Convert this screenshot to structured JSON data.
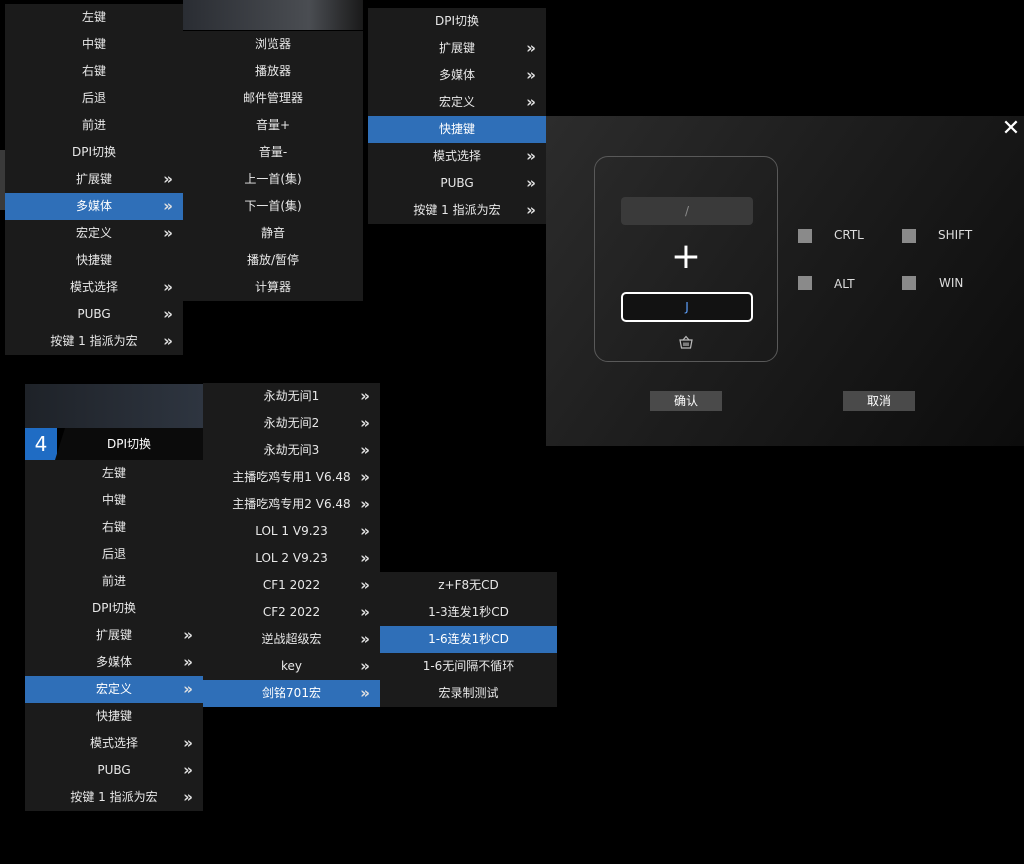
{
  "menu1": {
    "items": [
      {
        "label": "左键",
        "arrow": ""
      },
      {
        "label": "中键",
        "arrow": ""
      },
      {
        "label": "右键",
        "arrow": ""
      },
      {
        "label": "后退",
        "arrow": ""
      },
      {
        "label": "前进",
        "arrow": ""
      },
      {
        "label": "DPI切换",
        "arrow": ""
      },
      {
        "label": "扩展键",
        "arrow": "»"
      },
      {
        "label": "多媒体",
        "arrow": "»"
      },
      {
        "label": "宏定义",
        "arrow": "»"
      },
      {
        "label": "快捷键",
        "arrow": ""
      },
      {
        "label": "模式选择",
        "arrow": "»"
      },
      {
        "label": "PUBG",
        "arrow": "»"
      },
      {
        "label": "按键 1 指派为宏",
        "arrow": "»"
      }
    ],
    "selected_index": 7
  },
  "menu1_sub": {
    "items": [
      {
        "label": "浏览器"
      },
      {
        "label": "播放器"
      },
      {
        "label": "邮件管理器"
      },
      {
        "label": "音量+"
      },
      {
        "label": "音量-"
      },
      {
        "label": "上一首(集)"
      },
      {
        "label": "下一首(集)"
      },
      {
        "label": "静音"
      },
      {
        "label": "播放/暂停"
      },
      {
        "label": "计算器"
      }
    ]
  },
  "menu2": {
    "items": [
      {
        "label": "DPI切换",
        "arrow": ""
      },
      {
        "label": "扩展键",
        "arrow": "»"
      },
      {
        "label": "多媒体",
        "arrow": "»"
      },
      {
        "label": "宏定义",
        "arrow": "»"
      },
      {
        "label": "快捷键",
        "arrow": ""
      },
      {
        "label": "模式选择",
        "arrow": "»"
      },
      {
        "label": "PUBG",
        "arrow": "»"
      },
      {
        "label": "按键 1 指派为宏",
        "arrow": "»"
      }
    ],
    "selected_index": 4
  },
  "dialog": {
    "close_glyph": "✕",
    "display_value": "/",
    "plus_glyph": "+",
    "key_value": "J",
    "modifiers": [
      {
        "label": "CRTL"
      },
      {
        "label": "SHIFT"
      },
      {
        "label": "ALT"
      },
      {
        "label": "WIN"
      }
    ],
    "confirm_label": "确认",
    "cancel_label": "取消"
  },
  "menu3": {
    "header_number": "4",
    "header_label": "DPI切换",
    "items": [
      {
        "label": "左键",
        "arrow": ""
      },
      {
        "label": "中键",
        "arrow": ""
      },
      {
        "label": "右键",
        "arrow": ""
      },
      {
        "label": "后退",
        "arrow": ""
      },
      {
        "label": "前进",
        "arrow": ""
      },
      {
        "label": "DPI切换",
        "arrow": ""
      },
      {
        "label": "扩展键",
        "arrow": "»"
      },
      {
        "label": "多媒体",
        "arrow": "»"
      },
      {
        "label": "宏定义",
        "arrow": "»"
      },
      {
        "label": "快捷键",
        "arrow": ""
      },
      {
        "label": "模式选择",
        "arrow": "»"
      },
      {
        "label": "PUBG",
        "arrow": "»"
      },
      {
        "label": "按键 1 指派为宏",
        "arrow": "»"
      }
    ],
    "selected_index": 8
  },
  "menu3_sub": {
    "items": [
      {
        "label": "永劫无间1",
        "arrow": "»"
      },
      {
        "label": "永劫无间2",
        "arrow": "»"
      },
      {
        "label": "永劫无间3",
        "arrow": "»"
      },
      {
        "label": "主播吃鸡专用1 V6.48",
        "arrow": "»"
      },
      {
        "label": "主播吃鸡专用2 V6.48",
        "arrow": "»"
      },
      {
        "label": "LOL 1   V9.23",
        "arrow": "»"
      },
      {
        "label": "LOL 2   V9.23",
        "arrow": "»"
      },
      {
        "label": "CF1 2022",
        "arrow": "»"
      },
      {
        "label": "CF2   2022",
        "arrow": "»"
      },
      {
        "label": "逆战超级宏",
        "arrow": "»"
      },
      {
        "label": "key",
        "arrow": "»"
      },
      {
        "label": "剑铭701宏",
        "arrow": "»"
      }
    ],
    "selected_index": 11
  },
  "menu3_subsub": {
    "items": [
      {
        "label": "z+F8无CD"
      },
      {
        "label": "1-3连发1秒CD"
      },
      {
        "label": "1-6连发1秒CD"
      },
      {
        "label": "1-6无间隔不循环"
      },
      {
        "label": "宏录制测试"
      }
    ],
    "selected_index": 2
  },
  "icons": {
    "submenu_arrow": "chevron-double-right-icon",
    "clear": "basket-icon",
    "close": "close-icon"
  }
}
